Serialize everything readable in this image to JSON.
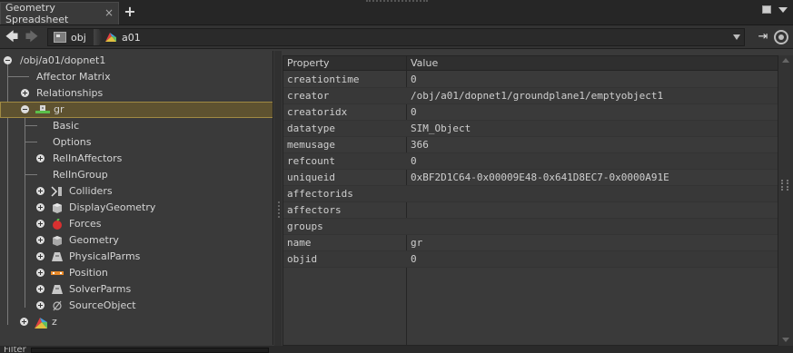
{
  "tabbar": {
    "tab_label": "Geometry Spreadsheet",
    "close_glyph": "×",
    "add_glyph": "+"
  },
  "pathbar": {
    "crumbs": [
      "obj",
      "a01"
    ],
    "back_glyph": "🡄",
    "fwd_glyph": "🡆",
    "pin_glyph": "⇥"
  },
  "tree": {
    "root": "/obj/a01/dopnet1",
    "items": [
      {
        "label": "Affector Matrix"
      },
      {
        "label": "Relationships"
      },
      {
        "label": "gr"
      },
      {
        "label": "Basic"
      },
      {
        "label": "Options"
      },
      {
        "label": "RelInAffectors"
      },
      {
        "label": "RelInGroup"
      },
      {
        "label": "Colliders"
      },
      {
        "label": "DisplayGeometry"
      },
      {
        "label": "Forces"
      },
      {
        "label": "Geometry"
      },
      {
        "label": "PhysicalParms"
      },
      {
        "label": "Position"
      },
      {
        "label": "SolverParms"
      },
      {
        "label": "SourceObject"
      },
      {
        "label": "z"
      }
    ],
    "selected": "gr",
    "filter_label": "Filter"
  },
  "table": {
    "headers": [
      "Property",
      "Value"
    ],
    "rows": [
      {
        "key": "creationtime",
        "value": "0"
      },
      {
        "key": "creator",
        "value": "/obj/a01/dopnet1/groundplane1/emptyobject1"
      },
      {
        "key": "creatoridx",
        "value": "0"
      },
      {
        "key": "datatype",
        "value": "SIM_Object"
      },
      {
        "key": "memusage",
        "value": "366"
      },
      {
        "key": "refcount",
        "value": "0"
      },
      {
        "key": "uniqueid",
        "value": "0xBF2D1C64-0x00009E48-0x641D8EC7-0x0000A91E"
      },
      {
        "key": "affectorids",
        "value": ""
      },
      {
        "key": "affectors",
        "value": ""
      },
      {
        "key": "groups",
        "value": ""
      },
      {
        "key": "name",
        "value": "gr"
      },
      {
        "key": "objid",
        "value": "0"
      }
    ]
  },
  "colors": {
    "background": "#3a3a3a",
    "selection": "#5e5230",
    "selection_border": "#a08a43"
  }
}
